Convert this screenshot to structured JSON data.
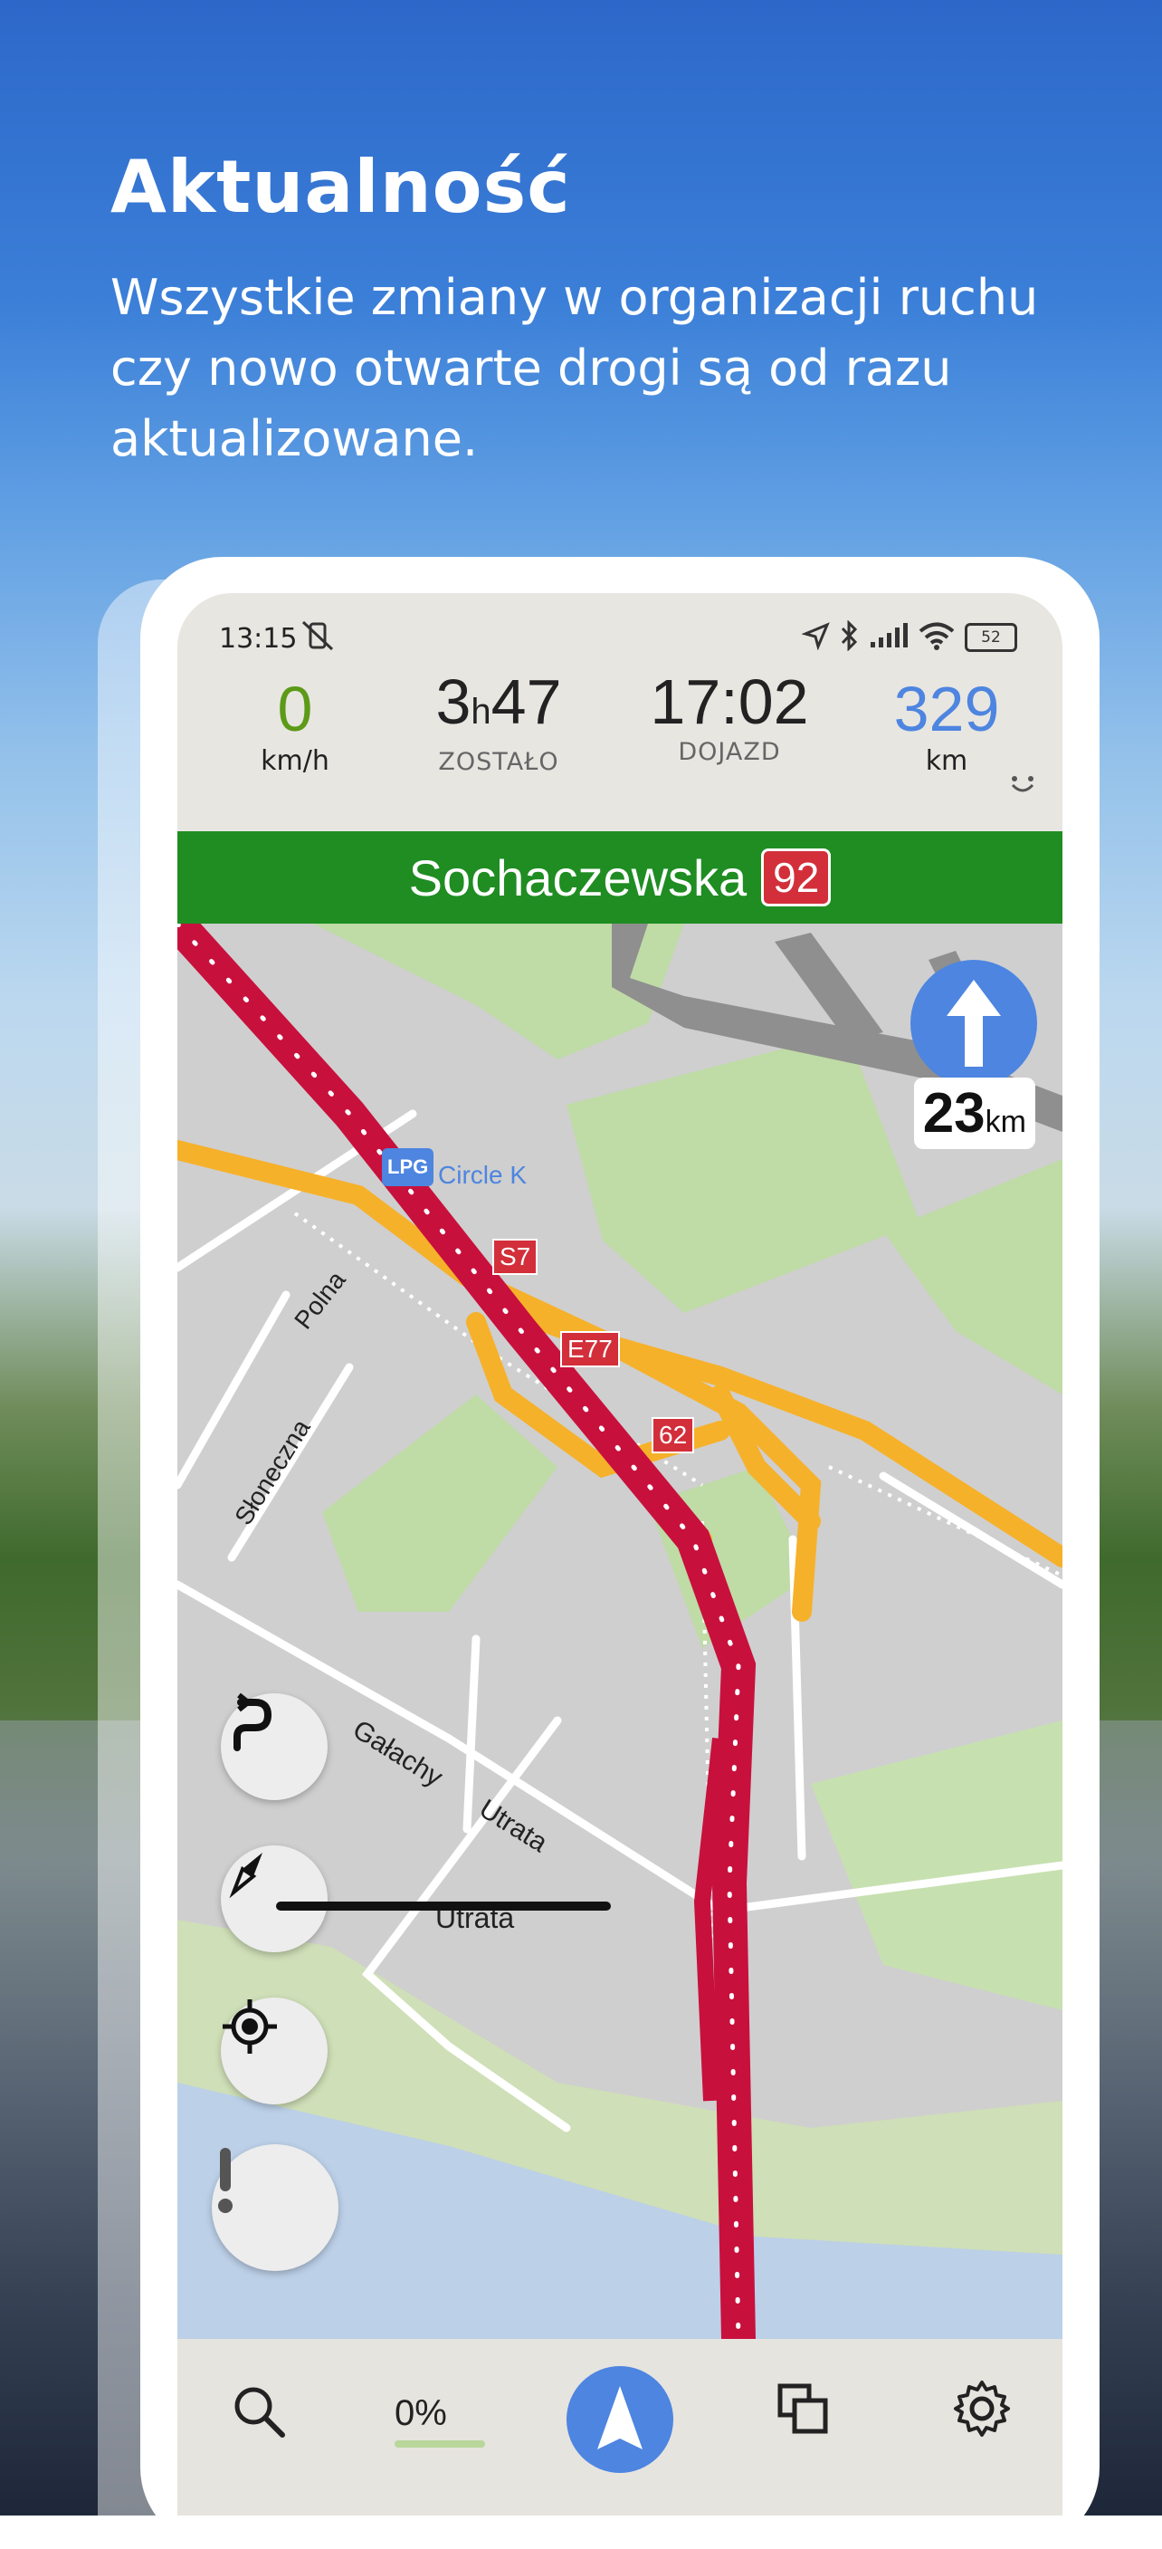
{
  "promo": {
    "headline": "Aktualność",
    "subtext": "Wszystkie zmiany w organizacji ruchu czy nowo otwarte drogi są od razu aktualizowane."
  },
  "status_bar": {
    "time": "13:15",
    "battery": "52"
  },
  "trip": {
    "speed": "0",
    "speed_unit": "km/h",
    "remaining_hours": "3",
    "remaining_h_unit": "h",
    "remaining_minutes": "47",
    "remaining_label": "ZOSTAŁO",
    "arrival_time": "17:02",
    "arrival_label": "DOJAZD",
    "distance": "329",
    "distance_unit": "km"
  },
  "banner": {
    "street": "Sochaczewska",
    "road_number": "92"
  },
  "next_turn": {
    "distance": "23",
    "unit": "km"
  },
  "map": {
    "labels": {
      "poi": "Circle K",
      "lpg": "LPG",
      "s7": "S7",
      "e77": "E77",
      "r62": "62",
      "polna": "Polna",
      "sloneczna": "Słoneczna",
      "galachy": "Gałachy",
      "utrata_street": "Utrata",
      "utrata_place": "Utrata"
    }
  },
  "bottom_bar": {
    "progress": "0%"
  },
  "colors": {
    "route": "#c8103d",
    "highway": "#f6b12a",
    "banner": "#1f8d22",
    "accent_blue": "#4d85e0",
    "speed_green": "#5c9a18"
  }
}
